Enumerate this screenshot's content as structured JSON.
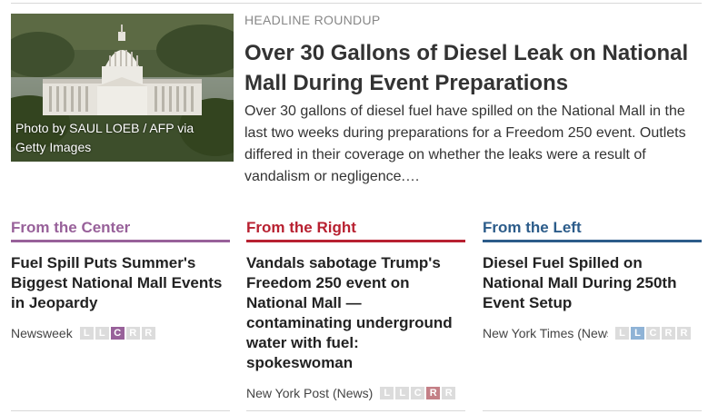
{
  "photo": {
    "credit": "Photo by SAUL LOEB / AFP via Getty Images",
    "subject": "capitol-building"
  },
  "lead": {
    "kicker": "HEADLINE ROUNDUP",
    "headline": "Over 30 Gallons of Diesel Leak on National Mall During Event Preparations",
    "summary": "Over 30 gallons of diesel fuel have spilled on the National Mall in the last two weeks during preparations for a Freedom 250 event. Outlets differed in their coverage on whether the leaks were a result of vandalism or negligence.…"
  },
  "columns": [
    {
      "label": "From the Center",
      "title": "Fuel Spill Puts Summer's Biggest National Mall Events in Jeopardy",
      "source": "Newsweek",
      "bias_rating": "C",
      "color": "#98619a"
    },
    {
      "label": "From the Right",
      "title": "Vandals sabotage Trump's Freedom 250 event on National Mall — contaminating underground water with fuel: spokeswoman",
      "source": "New York Post (News)",
      "bias_rating": "R",
      "color": "#b82131"
    },
    {
      "label": "From the Left",
      "title": "Diesel Fuel Spilled on National Mall During 250th Event Setup",
      "source": "New York Times (News)",
      "bias_rating": "L",
      "color": "#2c5c8a"
    }
  ],
  "bias_scale": [
    "L",
    "L",
    "C",
    "R",
    "R"
  ]
}
